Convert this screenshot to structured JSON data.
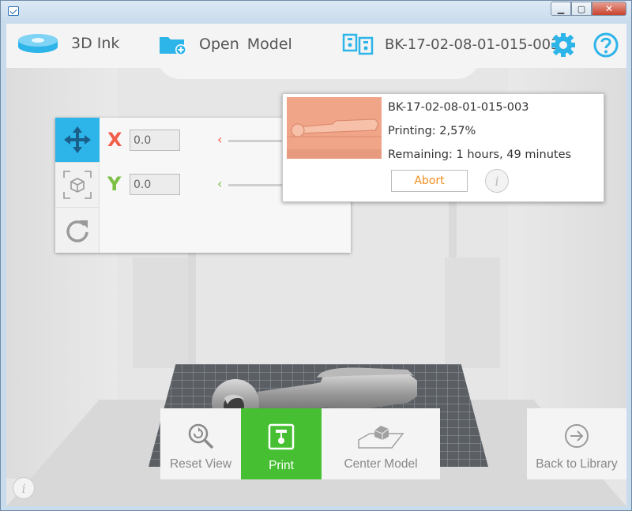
{
  "window": {
    "minimize_glyph": "▁",
    "maximize_glyph": "▢",
    "close_glyph": "✕"
  },
  "header": {
    "brand_label": "3D Ink",
    "open_model_label": "Open Model",
    "model_id": "BK-17-02-08-01-015-003"
  },
  "position_panel": {
    "x_label": "X",
    "y_label": "Y",
    "x_value": "0.0",
    "y_value": "0.0",
    "slider_chevron": "‹"
  },
  "print_popup": {
    "model_name": "BK-17-02-08-01-015-003",
    "status_text": "Printing: 2,57%",
    "remaining_text": "Remaining: 1 hours, 49 minutes",
    "abort_label": "Abort",
    "info_glyph": "i"
  },
  "bottom_bar": {
    "reset_view_label": "Reset View",
    "print_label": "Print",
    "center_model_label": "Center Model",
    "back_to_library_label": "Back to Library"
  },
  "colors": {
    "accent_blue": "#2db4e9",
    "print_green": "#46c032",
    "x_axis": "#f25e4a",
    "y_axis": "#7bc043",
    "abort_orange": "#f28c1c"
  },
  "corner_info_glyph": "i"
}
